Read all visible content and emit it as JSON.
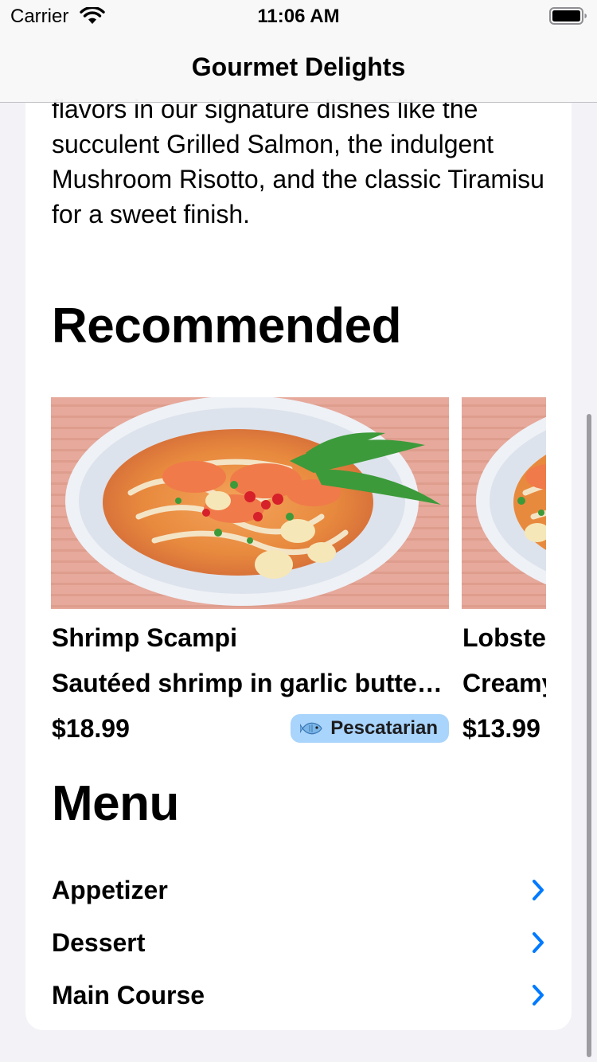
{
  "status_bar": {
    "carrier": "Carrier",
    "time": "11:06 AM",
    "wifi_icon": "wifi-icon",
    "battery_icon": "battery-full-icon"
  },
  "nav": {
    "title": "Gourmet Delights"
  },
  "intro_text": "flavors in our signature dishes like the succulent Grilled Salmon, the indulgent Mushroom Risotto, and the classic Tiramisu for a sweet finish.",
  "recommended": {
    "title": "Recommended",
    "items": [
      {
        "name": "Shrimp Scampi",
        "description": "Sautéed shrimp in garlic butter sauce",
        "price": "$18.99",
        "badge": "Pescatarian",
        "badge_icon": "fish-icon",
        "badge_color": "#a9d4fb"
      },
      {
        "name": "Lobster",
        "description": "Creamy",
        "price": "$13.99"
      }
    ]
  },
  "menu": {
    "title": "Menu",
    "categories": [
      {
        "label": "Appetizer",
        "icon": "chevron-right-icon"
      },
      {
        "label": "Dessert",
        "icon": "chevron-right-icon"
      },
      {
        "label": "Main Course",
        "icon": "chevron-right-icon"
      }
    ]
  },
  "colors": {
    "background": "#f2f2f7",
    "card": "#ffffff",
    "accent": "#007aff",
    "badge": "#a9d4fb"
  }
}
